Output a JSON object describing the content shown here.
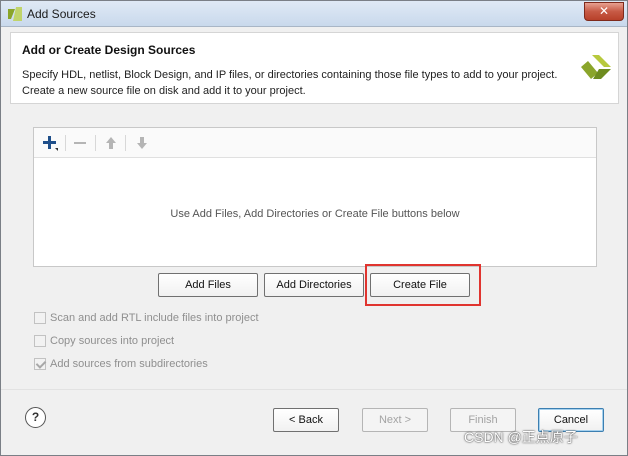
{
  "window": {
    "title": "Add Sources",
    "close_label": "✕"
  },
  "header": {
    "title": "Add or Create Design Sources",
    "line1": "Specify HDL, netlist, Block Design, and IP files, or directories containing those file types to add to your project.",
    "line2": "Create a new source file on disk and add it to your project."
  },
  "toolbar": {
    "icons": [
      "add-icon",
      "remove-icon",
      "move-up-icon",
      "move-down-icon"
    ]
  },
  "panel": {
    "empty_message": "Use Add Files, Add Directories or Create File buttons below"
  },
  "actions": {
    "add_files": "Add Files",
    "add_directories": "Add Directories",
    "create_file": "Create File"
  },
  "options": {
    "scan_rtl": {
      "label": "Scan and add RTL include files into project",
      "checked": false
    },
    "copy_sources": {
      "label": "Copy sources into project",
      "checked": false
    },
    "add_subdirs": {
      "label": "Add sources from subdirectories",
      "checked": true
    }
  },
  "footer": {
    "help": "?",
    "back": "< Back",
    "next": "Next >",
    "finish": "Finish",
    "cancel": "Cancel"
  },
  "watermark": "CSDN @正点原子",
  "colors": {
    "accent_logo": "#8aa52a",
    "highlight": "#e0342f",
    "title_bar": "#d4e1f1"
  }
}
